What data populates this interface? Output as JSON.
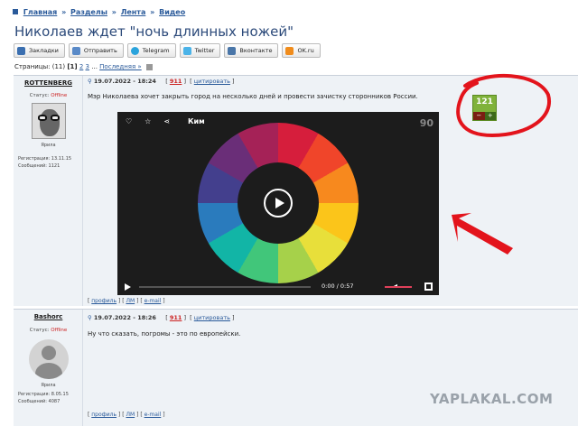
{
  "breadcrumbs": [
    "Главная",
    "Разделы",
    "Лента",
    "Видео"
  ],
  "title": "Николаев ждет \"ночь длинных ножей\"",
  "share_buttons": [
    "Закладки",
    "Отправить",
    "Telegram",
    "Twitter",
    "Вконтакте",
    "OK.ru"
  ],
  "pagination": {
    "label": "Страницы:",
    "count": "(11)",
    "current": "[1]",
    "p2": "2",
    "p3": "3",
    "dots": "...",
    "last": "Последняя »"
  },
  "posts": [
    {
      "author": "ROTTENBERG",
      "status_label": "Статус:",
      "status": "Offline",
      "rank": "Ярила",
      "reg": "Регистрация: 13.11.15",
      "messages": "Сообщений: 1121",
      "date": "19.07.2022 - 18:24",
      "post_no": "911",
      "quote": "цитировать",
      "text": "Мэр Николаева хочет закрыть город на несколько дней и провести зачистку сторонников России.",
      "footer": [
        "профиль",
        "ЛМ",
        "e-mail"
      ]
    },
    {
      "author": "Bashorc",
      "status_label": "Статус:",
      "status": "Offline",
      "rank": "Ярила",
      "reg": "Регистрация: 8.05.15",
      "messages": "Сообщений: 4087",
      "date": "19.07.2022 - 18:26",
      "post_no": "911",
      "quote": "цитировать",
      "text": "Ну что сказать, погромы - это по европейски.",
      "footer": [
        "профиль",
        "ЛМ",
        "e-mail"
      ]
    }
  ],
  "video": {
    "title": "Ким",
    "time": "0:00  /  0:57",
    "logo": "90"
  },
  "rating": {
    "value": "121",
    "minus": "−",
    "plus": "+"
  },
  "watermark": "YAPLAKAL.COM",
  "colors": {
    "link": "#2a5a9a",
    "offline": "#cc2222",
    "rating_green": "#7fb23a",
    "annotation_red": "#e3141c"
  }
}
